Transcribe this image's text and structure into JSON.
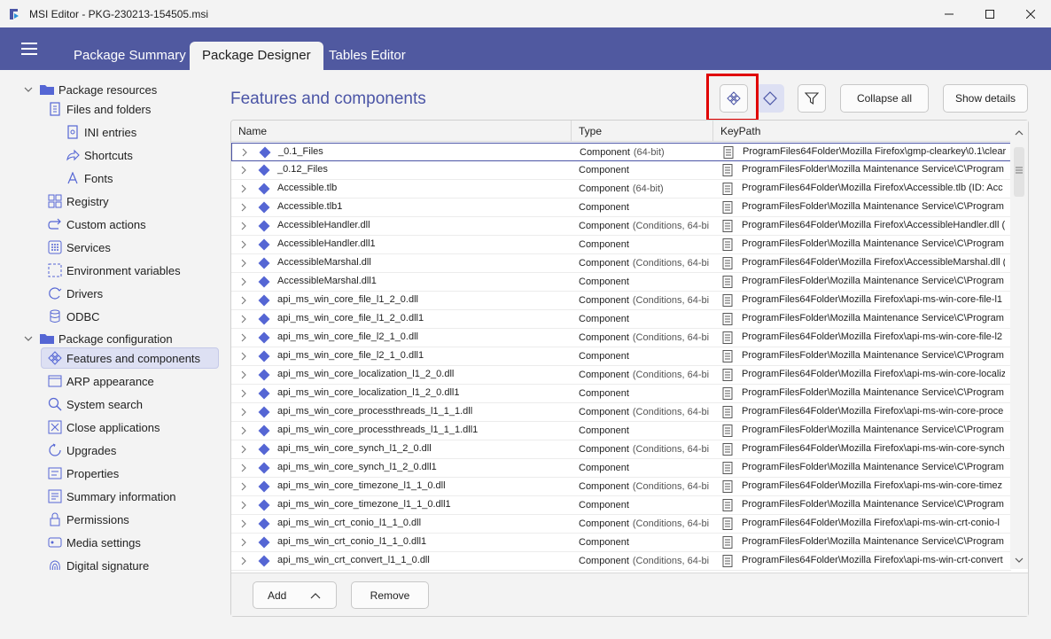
{
  "window": {
    "title": "MSI Editor - PKG-230213-154505.msi"
  },
  "tabs": [
    {
      "label": "Package Summary",
      "active": false
    },
    {
      "label": "Package Designer",
      "active": true
    },
    {
      "label": "Tables Editor",
      "active": false
    }
  ],
  "tree": {
    "group1": {
      "label": "Package resources",
      "items": [
        "Files and folders",
        "INI entries",
        "Shortcuts",
        "Fonts",
        "Registry",
        "Custom actions",
        "Services",
        "Environment variables",
        "Drivers",
        "ODBC"
      ]
    },
    "group2": {
      "label": "Package configuration",
      "items": [
        "Features and components",
        "ARP appearance",
        "System search",
        "Close applications",
        "Upgrades",
        "Properties",
        "Summary information",
        "Permissions",
        "Media settings",
        "Digital signature"
      ]
    },
    "selected": "Features and components"
  },
  "main": {
    "title": "Features and components",
    "collapse_label": "Collapse all",
    "details_label": "Show details",
    "columns": [
      "Name",
      "Type",
      "KeyPath"
    ],
    "add_label": "Add",
    "remove_label": "Remove"
  },
  "rows": [
    {
      "name": "_0.1_Files",
      "type": "Component",
      "sub": "(64-bit)",
      "key": "ProgramFiles64Folder\\Mozilla Firefox\\gmp-clearkey\\0.1\\clear"
    },
    {
      "name": "_0.12_Files",
      "type": "Component",
      "sub": "",
      "key": "ProgramFilesFolder\\Mozilla Maintenance Service\\C\\Program"
    },
    {
      "name": "Accessible.tlb",
      "type": "Component",
      "sub": "(64-bit)",
      "key": "ProgramFiles64Folder\\Mozilla Firefox\\Accessible.tlb  (ID: Acc"
    },
    {
      "name": "Accessible.tlb1",
      "type": "Component",
      "sub": "",
      "key": "ProgramFilesFolder\\Mozilla Maintenance Service\\C\\Program"
    },
    {
      "name": "AccessibleHandler.dll",
      "type": "Component",
      "sub": "(Conditions, 64-bi",
      "key": "ProgramFiles64Folder\\Mozilla Firefox\\AccessibleHandler.dll  ("
    },
    {
      "name": "AccessibleHandler.dll1",
      "type": "Component",
      "sub": "",
      "key": "ProgramFilesFolder\\Mozilla Maintenance Service\\C\\Program"
    },
    {
      "name": "AccessibleMarshal.dll",
      "type": "Component",
      "sub": "(Conditions, 64-bi",
      "key": "ProgramFiles64Folder\\Mozilla Firefox\\AccessibleMarshal.dll  ("
    },
    {
      "name": "AccessibleMarshal.dll1",
      "type": "Component",
      "sub": "",
      "key": "ProgramFilesFolder\\Mozilla Maintenance Service\\C\\Program"
    },
    {
      "name": "api_ms_win_core_file_l1_2_0.dll",
      "type": "Component",
      "sub": "(Conditions, 64-bi",
      "key": "ProgramFiles64Folder\\Mozilla Firefox\\api-ms-win-core-file-l1"
    },
    {
      "name": "api_ms_win_core_file_l1_2_0.dll1",
      "type": "Component",
      "sub": "",
      "key": "ProgramFilesFolder\\Mozilla Maintenance Service\\C\\Program"
    },
    {
      "name": "api_ms_win_core_file_l2_1_0.dll",
      "type": "Component",
      "sub": "(Conditions, 64-bi",
      "key": "ProgramFiles64Folder\\Mozilla Firefox\\api-ms-win-core-file-l2"
    },
    {
      "name": "api_ms_win_core_file_l2_1_0.dll1",
      "type": "Component",
      "sub": "",
      "key": "ProgramFilesFolder\\Mozilla Maintenance Service\\C\\Program"
    },
    {
      "name": "api_ms_win_core_localization_l1_2_0.dll",
      "type": "Component",
      "sub": "(Conditions, 64-bi",
      "key": "ProgramFiles64Folder\\Mozilla Firefox\\api-ms-win-core-localiz"
    },
    {
      "name": "api_ms_win_core_localization_l1_2_0.dll1",
      "type": "Component",
      "sub": "",
      "key": "ProgramFilesFolder\\Mozilla Maintenance Service\\C\\Program"
    },
    {
      "name": "api_ms_win_core_processthreads_l1_1_1.dll",
      "type": "Component",
      "sub": "(Conditions, 64-bi",
      "key": "ProgramFiles64Folder\\Mozilla Firefox\\api-ms-win-core-proce"
    },
    {
      "name": "api_ms_win_core_processthreads_l1_1_1.dll1",
      "type": "Component",
      "sub": "",
      "key": "ProgramFilesFolder\\Mozilla Maintenance Service\\C\\Program"
    },
    {
      "name": "api_ms_win_core_synch_l1_2_0.dll",
      "type": "Component",
      "sub": "(Conditions, 64-bi",
      "key": "ProgramFiles64Folder\\Mozilla Firefox\\api-ms-win-core-synch"
    },
    {
      "name": "api_ms_win_core_synch_l1_2_0.dll1",
      "type": "Component",
      "sub": "",
      "key": "ProgramFilesFolder\\Mozilla Maintenance Service\\C\\Program"
    },
    {
      "name": "api_ms_win_core_timezone_l1_1_0.dll",
      "type": "Component",
      "sub": "(Conditions, 64-bi",
      "key": "ProgramFiles64Folder\\Mozilla Firefox\\api-ms-win-core-timez"
    },
    {
      "name": "api_ms_win_core_timezone_l1_1_0.dll1",
      "type": "Component",
      "sub": "",
      "key": "ProgramFilesFolder\\Mozilla Maintenance Service\\C\\Program"
    },
    {
      "name": "api_ms_win_crt_conio_l1_1_0.dll",
      "type": "Component",
      "sub": "(Conditions, 64-bi",
      "key": "ProgramFiles64Folder\\Mozilla Firefox\\api-ms-win-crt-conio-l"
    },
    {
      "name": "api_ms_win_crt_conio_l1_1_0.dll1",
      "type": "Component",
      "sub": "",
      "key": "ProgramFilesFolder\\Mozilla Maintenance Service\\C\\Program"
    },
    {
      "name": "api_ms_win_crt_convert_l1_1_0.dll",
      "type": "Component",
      "sub": "(Conditions, 64-bi",
      "key": "ProgramFiles64Folder\\Mozilla Firefox\\api-ms-win-crt-convert"
    }
  ],
  "colors": {
    "accent": "#5059a0",
    "diamond": "#5566d4",
    "highlight": "#e00000",
    "title": "#4b55a6"
  }
}
